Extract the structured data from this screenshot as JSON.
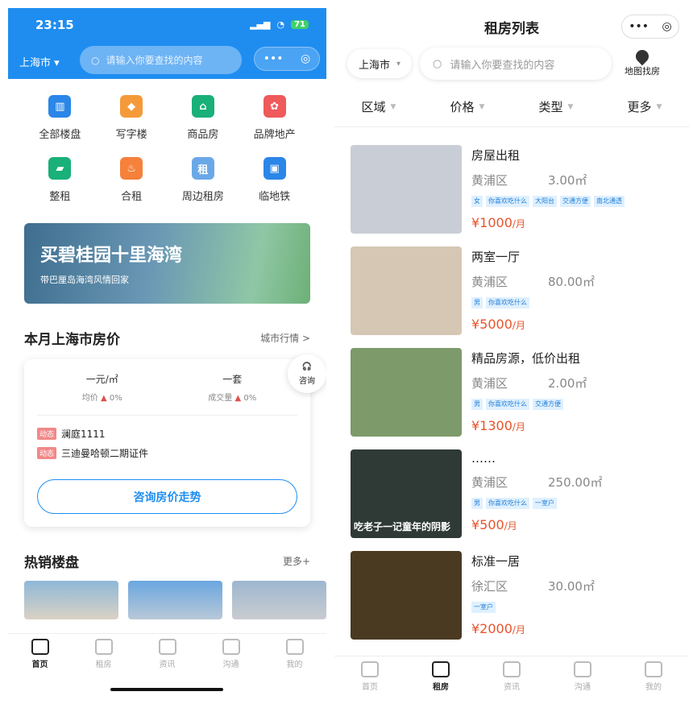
{
  "left": {
    "status": {
      "time": "23:15",
      "battery": "71"
    },
    "city": "上海市",
    "search_placeholder": "请输入你要查找的内容",
    "capsule": {
      "more": "•••",
      "close": "◎"
    },
    "categories": [
      {
        "label": "全部楼盘",
        "color": "#2a86e8"
      },
      {
        "label": "写字楼",
        "color": "#f59a3a"
      },
      {
        "label": "商品房",
        "color": "#19b07a"
      },
      {
        "label": "品牌地产",
        "color": "#ef5a5a"
      },
      {
        "label": "整租",
        "color": "#19b07a"
      },
      {
        "label": "合租",
        "color": "#f5813a"
      },
      {
        "label": "周边租房",
        "color": "#6aa8e8"
      },
      {
        "label": "临地铁",
        "color": "#2a86e8"
      }
    ],
    "rent_icon_char": "租",
    "banner": {
      "title": "买碧桂园十里海湾",
      "subtitle": "带巴厘岛海湾风情回家"
    },
    "price_section": {
      "title": "本月上海市房价",
      "more": "城市行情 >"
    },
    "stats": [
      {
        "value": "一元/㎡",
        "label": "均价",
        "change": "0%"
      },
      {
        "value": "一套",
        "label": "成交量",
        "change": "0%"
      }
    ],
    "consult_label": "咨询",
    "news_tag": "动态",
    "news": [
      "澜庭1111",
      "三迪曼哈顿二期证件"
    ],
    "consult_button": "咨询房价走势",
    "hot_section": {
      "title": "热销楼盘",
      "more": "更多+"
    },
    "tabs": [
      "首页",
      "租房",
      "资讯",
      "沟通",
      "我的"
    ]
  },
  "right": {
    "title": "租房列表",
    "city": "上海市",
    "search_placeholder": "请输入你要查找的内容",
    "map_label": "地图找房",
    "filters": [
      "区域",
      "价格",
      "类型",
      "更多"
    ],
    "listings": [
      {
        "title": "房屋出租",
        "district": "黄浦区",
        "area": "3.00㎡",
        "tags": [
          "女",
          "你喜欢吃什么",
          "大阳台",
          "交通方便",
          "南北通透"
        ],
        "price": "¥1000",
        "unit": "/月",
        "thumb": "#c9cdd6",
        "caption": ""
      },
      {
        "title": "两室一厅",
        "district": "黄浦区",
        "area": "80.00㎡",
        "tags": [
          "男",
          "你喜欢吃什么"
        ],
        "price": "¥5000",
        "unit": "/月",
        "thumb": "#d6c7b4",
        "caption": ""
      },
      {
        "title": "精品房源，低价出租",
        "district": "黄浦区",
        "area": "2.00㎡",
        "tags": [
          "男",
          "你喜欢吃什么",
          "交通方便"
        ],
        "price": "¥1300",
        "unit": "/月",
        "thumb": "#7d9a6a",
        "caption": ""
      },
      {
        "title": "……",
        "district": "黄浦区",
        "area": "250.00㎡",
        "tags": [
          "男",
          "你喜欢吃什么",
          "一室户"
        ],
        "price": "¥500",
        "unit": "/月",
        "thumb": "#2f3a36",
        "caption": "吃老子一记童年的阴影"
      },
      {
        "title": "标准一居",
        "district": "徐汇区",
        "area": "30.00㎡",
        "tags": [
          "一室户"
        ],
        "price": "¥2000",
        "unit": "/月",
        "thumb": "#4a3a22",
        "caption": ""
      }
    ],
    "tabs": [
      "首页",
      "租房",
      "资讯",
      "沟通",
      "我的"
    ],
    "active_tab": "租房"
  }
}
